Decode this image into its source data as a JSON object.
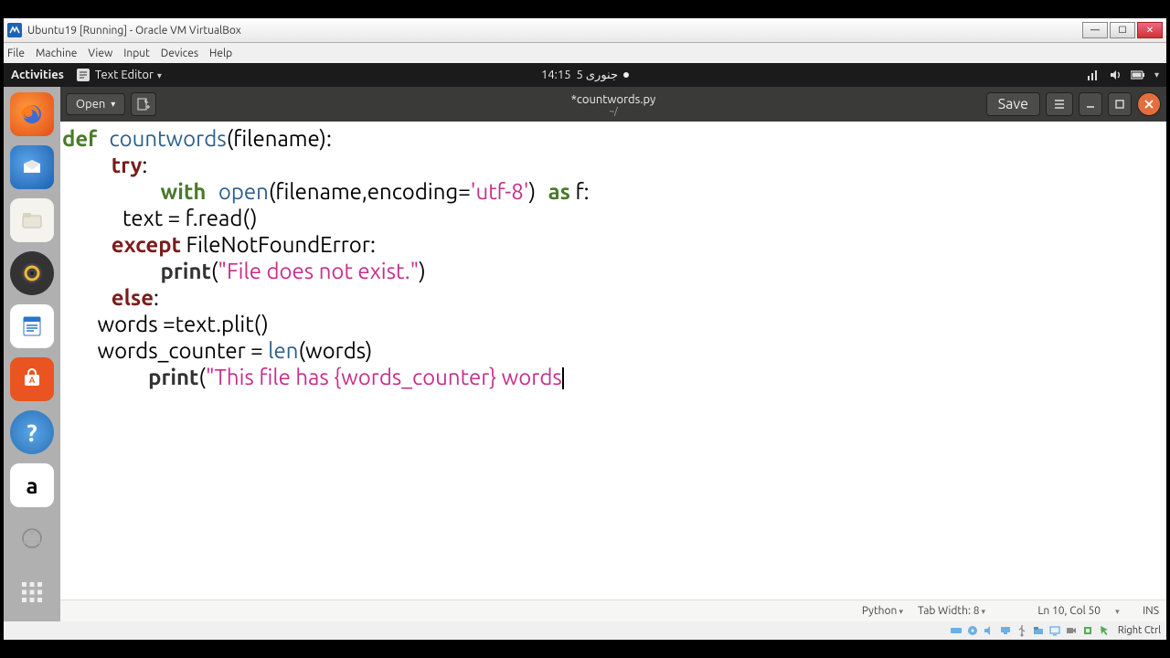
{
  "vb": {
    "title": "Ubuntu19 [Running] - Oracle VM VirtualBox",
    "menu": [
      "File",
      "Machine",
      "View",
      "Input",
      "Devices",
      "Help"
    ],
    "host_key": "Right Ctrl"
  },
  "gnome": {
    "activities": "Activities",
    "app_label": "Text Editor",
    "clock": "14:15",
    "date_arabic": "جنوری 5"
  },
  "gedit": {
    "open_label": "Open",
    "save_label": "Save",
    "file_title": "*countwords.py",
    "file_subtitle": "~/",
    "status": {
      "language": "Python",
      "tab_width_label": "Tab Width: 8",
      "cursor": "Ln 10, Col 50",
      "insert_mode": "INS"
    }
  },
  "code": {
    "l1": {
      "def": "def",
      "name": "countwords",
      "rest": "(filename):"
    },
    "l2": {
      "try": "try",
      "colon": ":"
    },
    "l3": {
      "with": "with",
      "open": "open",
      "args1": "(filename,encoding=",
      "str": "'utf-8'",
      "args2": ")",
      "as": "as",
      "var": " f:"
    },
    "l4": "            text = f.read()",
    "l5": {
      "except": "except",
      "err": " FileNotFoundError:"
    },
    "l6": {
      "print": "print",
      "open": "(",
      "str": "\"File does not exist.\"",
      "close": ")"
    },
    "l7": {
      "else": "else",
      "colon": ":"
    },
    "l8": "       words =text.plit()",
    "l9": {
      "a": "       words_counter = ",
      "len": "len",
      "b": "(words)"
    },
    "l10": {
      "print": "print",
      "open": "(",
      "str": "\"This file has {words_counter} words"
    }
  }
}
